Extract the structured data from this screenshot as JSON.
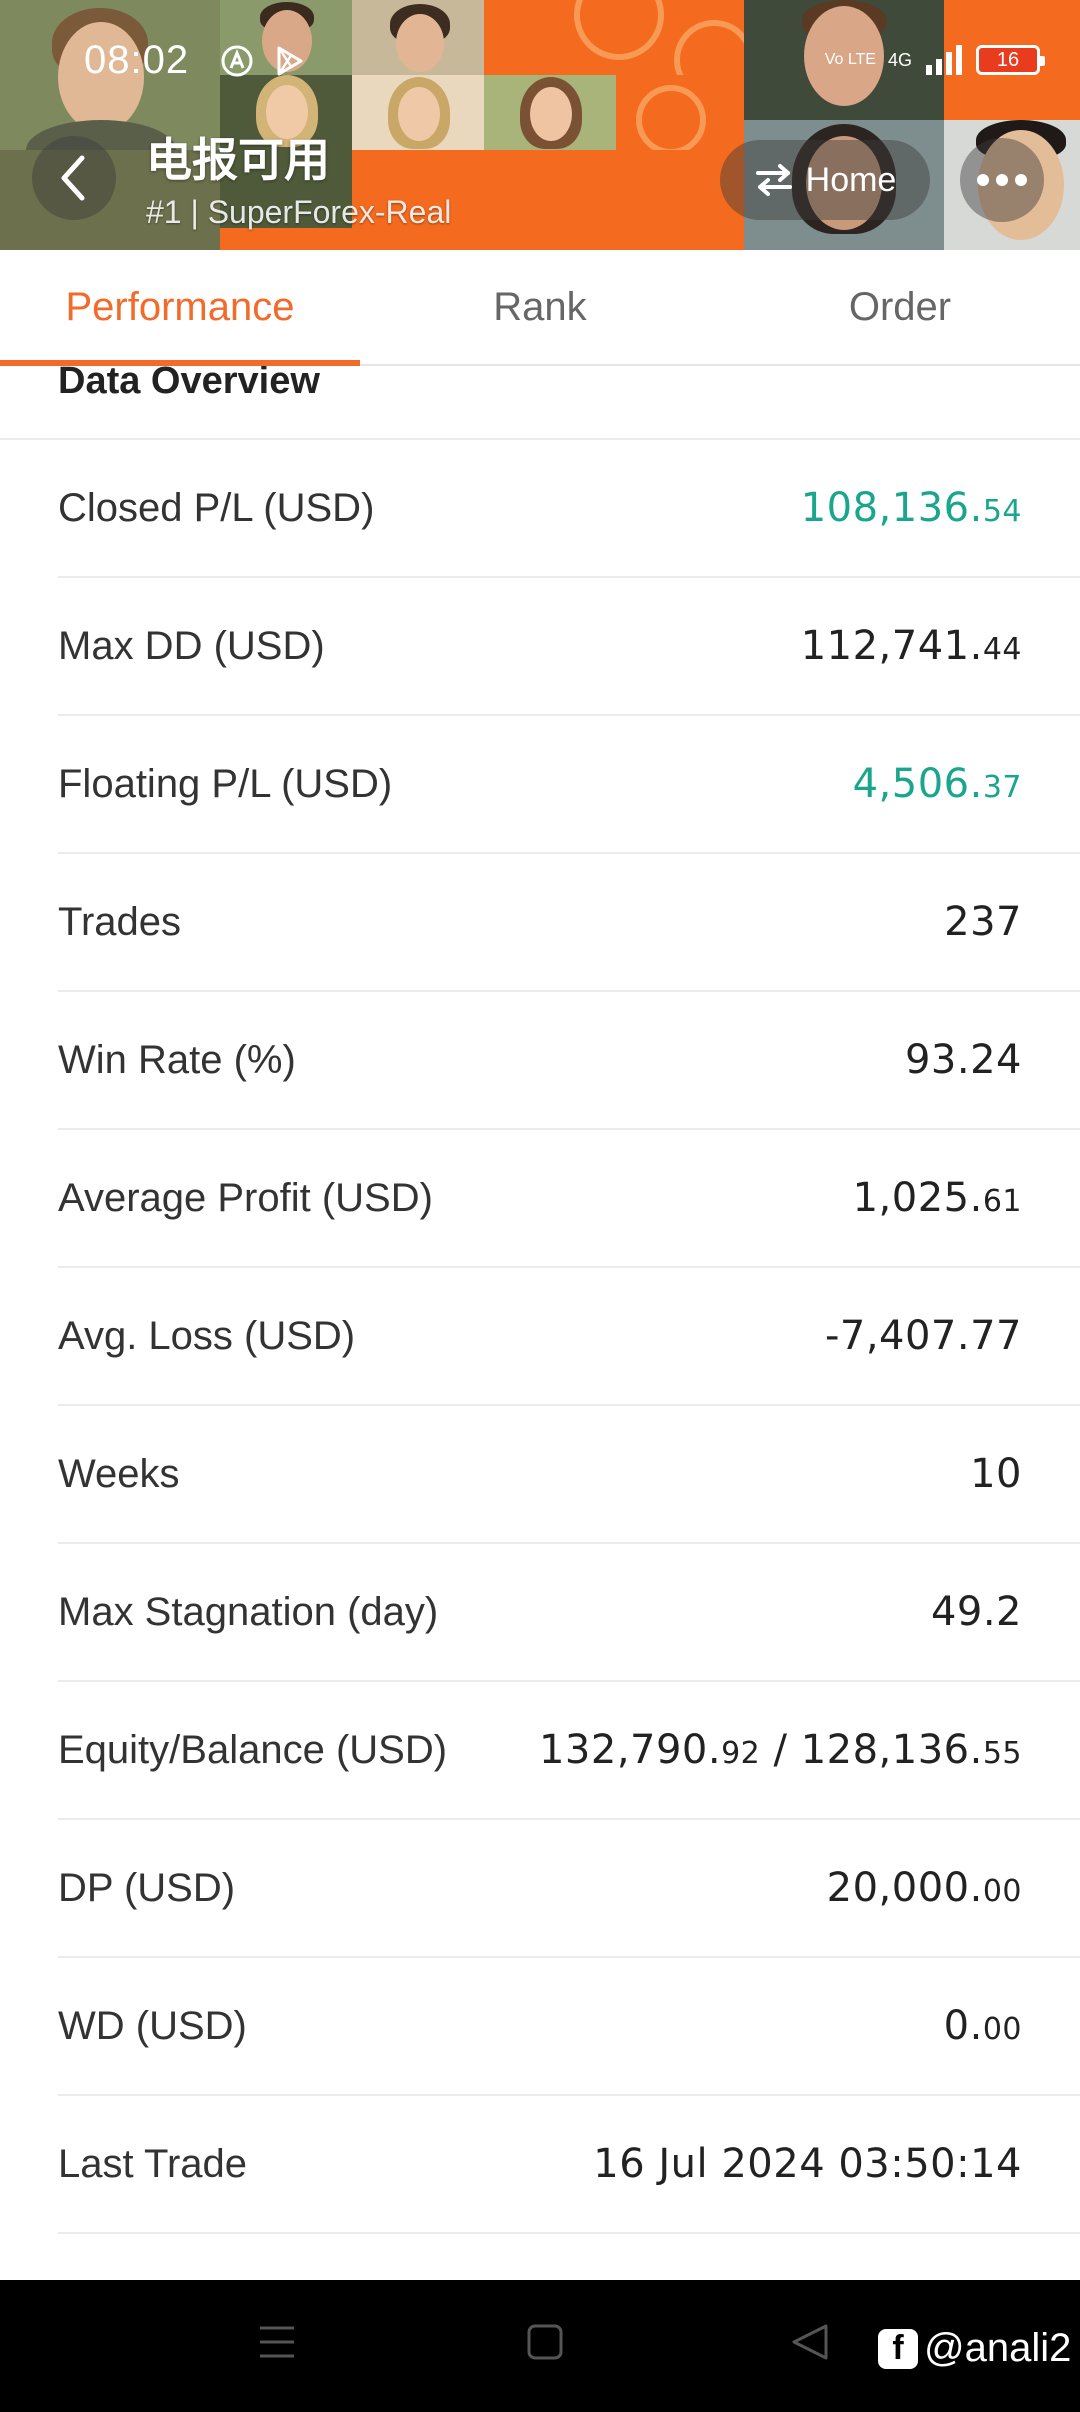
{
  "status_bar": {
    "time": "08:02",
    "network": "4G",
    "volte": "Vo LTE",
    "battery": "16"
  },
  "header": {
    "title": "电报可用",
    "subtitle": "#1 | SuperForex-Real",
    "home_label": "Home",
    "accent_color": "#f46a1e"
  },
  "tabs": [
    {
      "label": "Performance",
      "active": true
    },
    {
      "label": "Rank",
      "active": false
    },
    {
      "label": "Order",
      "active": false
    }
  ],
  "section": {
    "title": "Data Overview"
  },
  "rows": [
    {
      "label": "Closed P/L (USD)",
      "value_main": "108,136.",
      "value_small": "54",
      "color": "green"
    },
    {
      "label": "Max DD (USD)",
      "value_main": "112,741.",
      "value_small": "44",
      "color": "default"
    },
    {
      "label": "Floating P/L (USD)",
      "value_main": "4,506.",
      "value_small": "37",
      "color": "green"
    },
    {
      "label": "Trades",
      "value_main": "237",
      "value_small": "",
      "color": "default"
    },
    {
      "label": "Win Rate (%)",
      "value_main": "93.24",
      "value_small": "",
      "color": "default"
    },
    {
      "label": "Average Profit (USD)",
      "value_main": "1,025.",
      "value_small": "61",
      "color": "default"
    },
    {
      "label": "Avg. Loss (USD)",
      "value_main": "-7,407.77",
      "value_small": "",
      "color": "default"
    },
    {
      "label": "Weeks",
      "value_main": "10",
      "value_small": "",
      "color": "default"
    },
    {
      "label": "Max Stagnation (day)",
      "value_main": "49.2",
      "value_small": "",
      "color": "default"
    },
    {
      "label": "Equity/Balance (USD)",
      "value_main": "132,790.",
      "value_small": "92",
      "value_main2": " / 128,136.",
      "value_small2": "55",
      "color": "default"
    },
    {
      "label": "DP (USD)",
      "value_main": "20,000.",
      "value_small": "00",
      "color": "default"
    },
    {
      "label": "WD (USD)",
      "value_main": "0.",
      "value_small": "00",
      "color": "default"
    },
    {
      "label": "Last Trade",
      "value_main": "16 Jul 2024 03:50:14",
      "value_small": "",
      "color": "default"
    }
  ],
  "watermark": {
    "logo": "f",
    "handle": "@anali2"
  },
  "colors": {
    "green": "#1aa68d",
    "orange": "#f26b2a"
  }
}
